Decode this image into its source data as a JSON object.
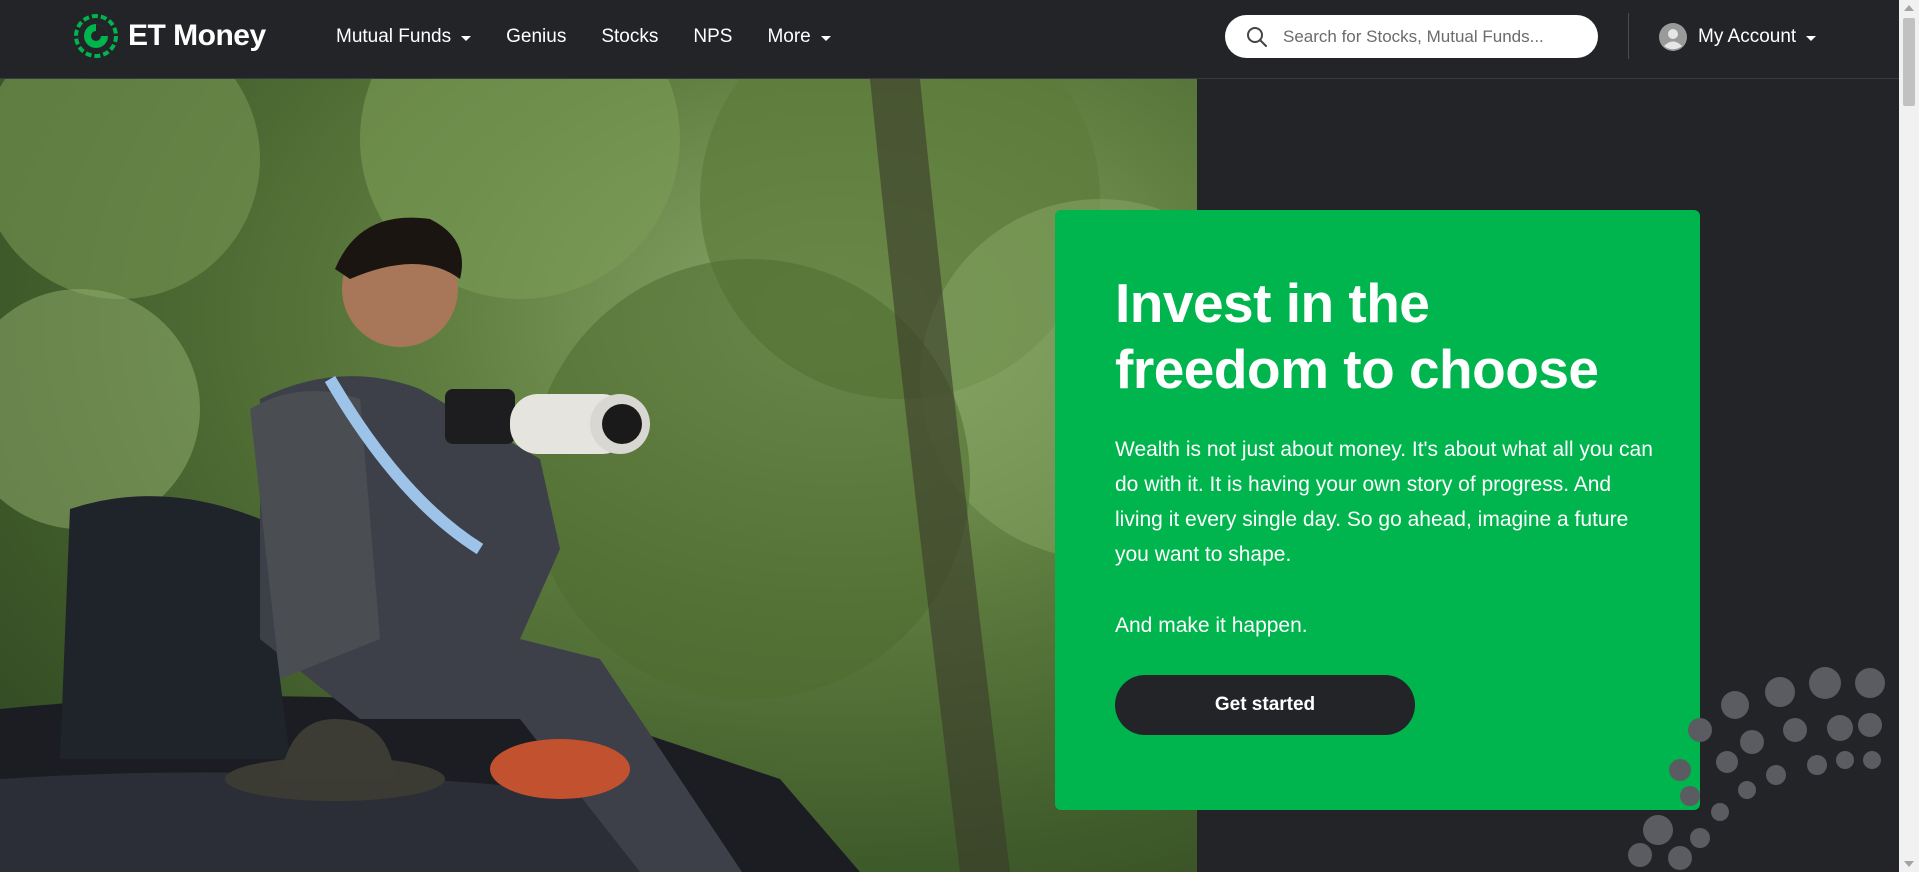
{
  "brand": {
    "name": "ET Money",
    "accent_color": "#00b54e",
    "dark_color": "#232427"
  },
  "nav": {
    "items": [
      {
        "label": "Mutual Funds",
        "has_dropdown": true
      },
      {
        "label": "Genius",
        "has_dropdown": false
      },
      {
        "label": "Stocks",
        "has_dropdown": false
      },
      {
        "label": "NPS",
        "has_dropdown": false
      },
      {
        "label": "More",
        "has_dropdown": true
      }
    ]
  },
  "search": {
    "icon": "search-icon",
    "placeholder": "Search for Stocks, Mutual Funds..."
  },
  "account": {
    "icon": "user-avatar-icon",
    "label": "My Account"
  },
  "hero": {
    "photo": "photographer-with-camera-on-vehicle",
    "title": "Invest in the freedom to choose",
    "paragraph_1": "Wealth is not just about money. It's about what all you can do with it. It is having your own story of progress. And living it every single day. So go ahead, imagine a future you want to shape.",
    "paragraph_2": "And make it happen.",
    "cta_label": "Get started"
  }
}
